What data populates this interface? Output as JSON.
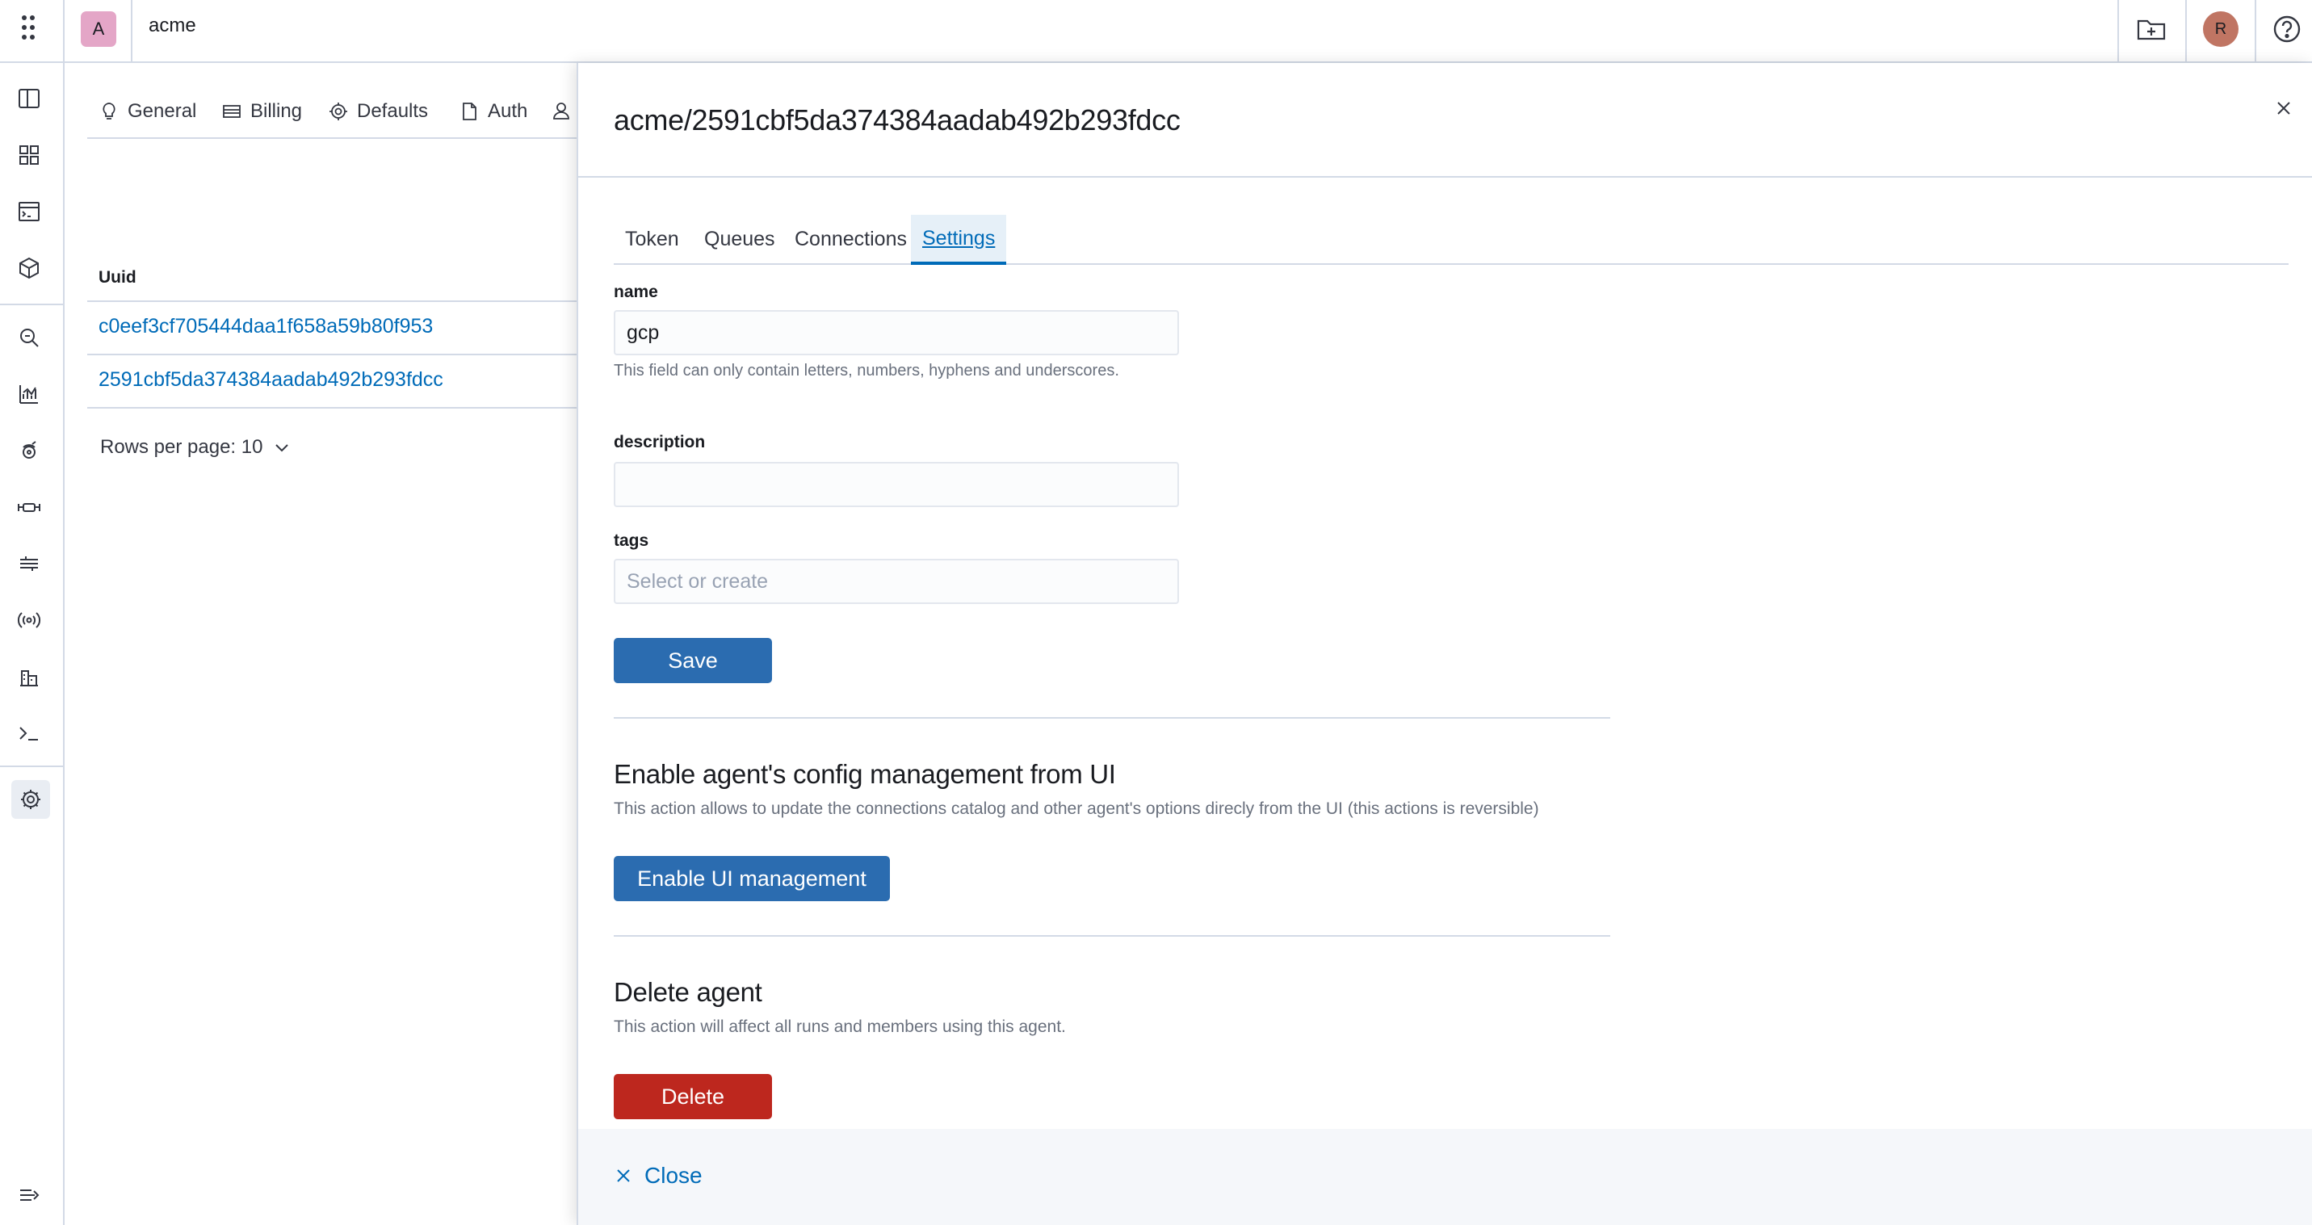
{
  "topbar": {
    "org_initial": "A",
    "org_name": "acme",
    "user_initial": "R"
  },
  "rail": {
    "icons": [
      "sidebar-toggle-icon",
      "dashboard-icon",
      "terminal-window-icon",
      "cube-icon",
      "search-icon",
      "analytics-icon",
      "hub-icon",
      "pipeline-icon",
      "queue-icon",
      "broadcast-icon",
      "buildings-icon",
      "terminal-prompt-icon",
      "settings-icon",
      "expand-icon"
    ]
  },
  "background": {
    "tabs": [
      {
        "label": "General",
        "icon": "lightbulb-icon"
      },
      {
        "label": "Billing",
        "icon": "card-icon"
      },
      {
        "label": "Defaults",
        "icon": "gear-icon"
      },
      {
        "label": "Auth",
        "icon": "document-icon"
      }
    ],
    "table": {
      "header": "Uuid",
      "rows": [
        "c0eef3cf705444daa1f658a59b80f953",
        "2591cbf5da374384aadab492b293fdcc"
      ]
    },
    "rows_per_page": "Rows per page: 10"
  },
  "flyout": {
    "title": "acme/2591cbf5da374384aadab492b293fdcc",
    "tabs": [
      "Token",
      "Queues",
      "Connections",
      "Settings"
    ],
    "active_tab": "Settings",
    "form": {
      "name_label": "name",
      "name_value": "gcp",
      "name_help": "This field can only contain letters, numbers, hyphens and underscores.",
      "description_label": "description",
      "description_value": "",
      "tags_label": "tags",
      "tags_placeholder": "Select or create",
      "save_label": "Save"
    },
    "ui_management": {
      "title": "Enable agent's config management from UI",
      "description": "This action allows to update the connections catalog and other agent's options direcly from the UI (this actions is reversible)",
      "button_label": "Enable UI management"
    },
    "delete": {
      "title": "Delete agent",
      "description": "This action will affect all runs and members using this agent.",
      "button_label": "Delete"
    },
    "footer_close_label": "Close"
  },
  "colors": {
    "primary": "#2b6cb0",
    "danger": "#bd271e",
    "link": "#006bb8",
    "org_avatar": "#e4a6c7",
    "user_avatar": "#c07563"
  }
}
